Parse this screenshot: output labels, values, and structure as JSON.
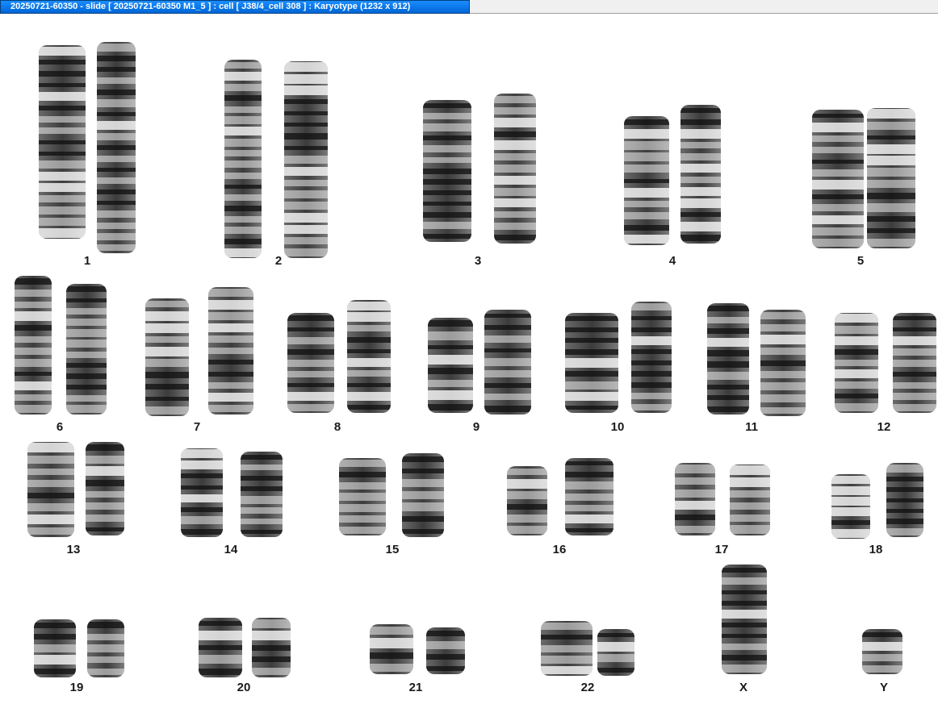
{
  "window": {
    "title": "20250721-60350 - slide [ 20250721-60350 M1_5 ] : cell [ J38/4_cell 308 ] : Karyotype  (1232 x 912)"
  },
  "karyotype": {
    "chromosomes": [
      {
        "label": "1"
      },
      {
        "label": "2"
      },
      {
        "label": "3"
      },
      {
        "label": "4"
      },
      {
        "label": "5"
      },
      {
        "label": "6"
      },
      {
        "label": "7"
      },
      {
        "label": "8"
      },
      {
        "label": "9"
      },
      {
        "label": "10"
      },
      {
        "label": "11"
      },
      {
        "label": "12"
      },
      {
        "label": "13"
      },
      {
        "label": "14"
      },
      {
        "label": "15"
      },
      {
        "label": "16"
      },
      {
        "label": "17"
      },
      {
        "label": "18"
      },
      {
        "label": "19"
      },
      {
        "label": "20"
      },
      {
        "label": "21"
      },
      {
        "label": "22"
      },
      {
        "label": "X"
      },
      {
        "label": "Y"
      }
    ]
  },
  "colors": {
    "title_bg": "#0a72e8",
    "title_text": "#ffffff",
    "chromosome": "#3c3c3c"
  }
}
